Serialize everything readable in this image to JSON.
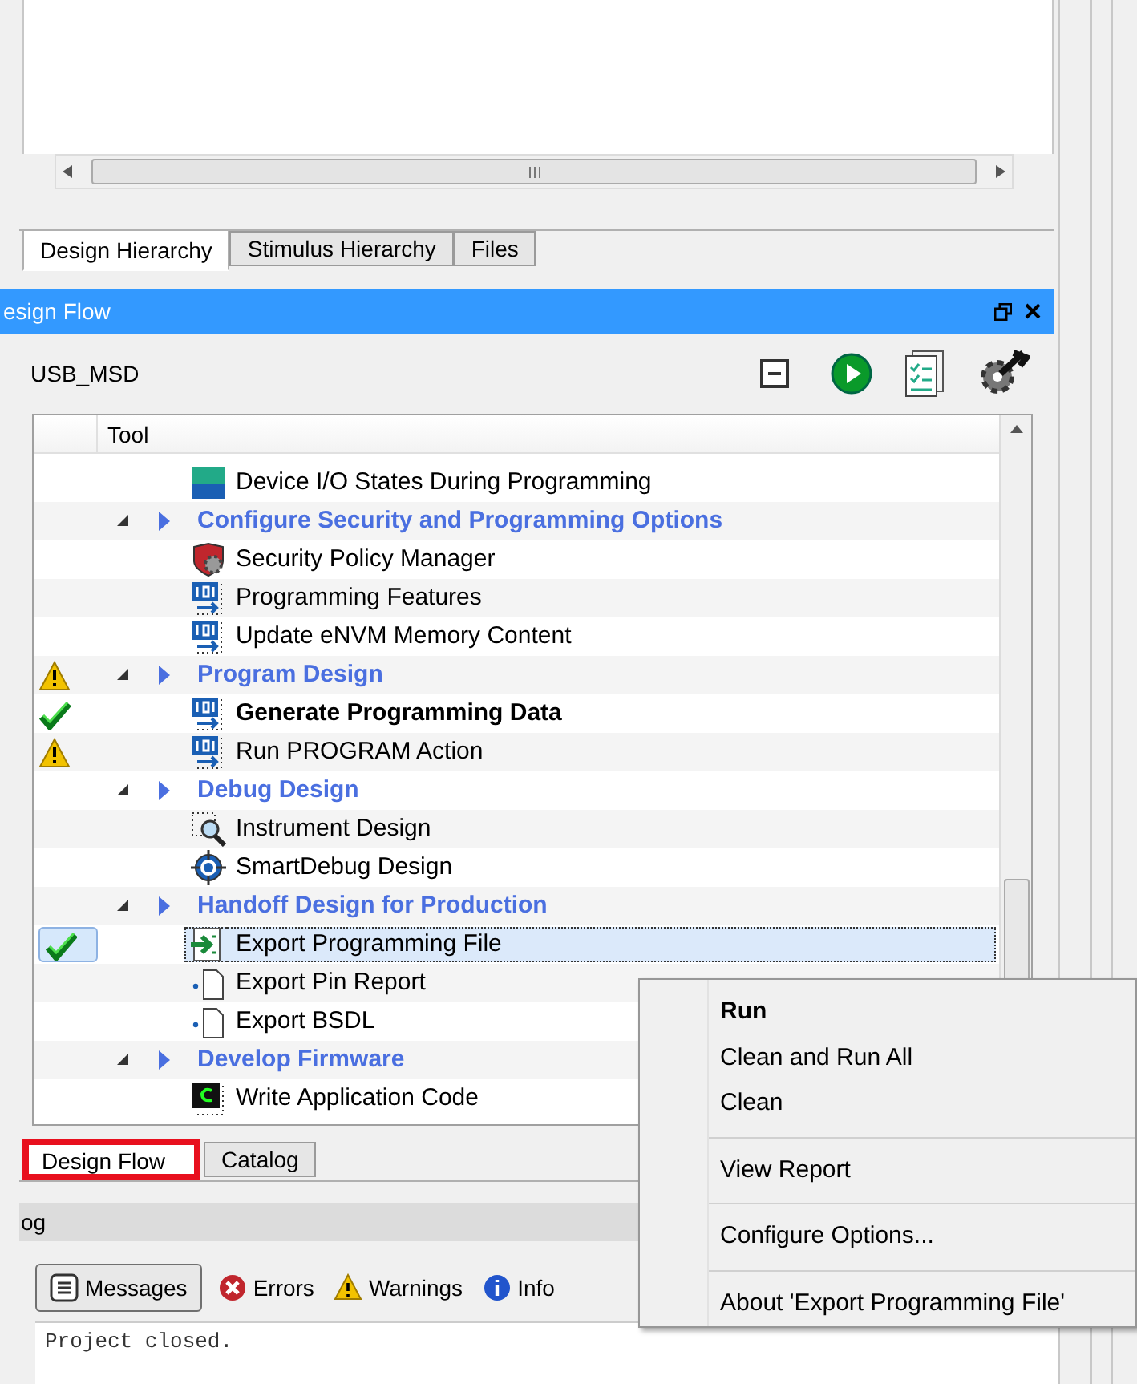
{
  "top_tabs": [
    {
      "label": "Design Hierarchy",
      "selected": true
    },
    {
      "label": "Stimulus Hierarchy",
      "selected": false
    },
    {
      "label": "Files",
      "selected": false
    }
  ],
  "panel": {
    "title": "esign Flow",
    "project": "USB_MSD"
  },
  "tree": {
    "column": "Tool",
    "items": [
      {
        "kind": "io",
        "label": "Device I/O States During Programming",
        "warning": false,
        "done": false,
        "bold": false,
        "selected": false
      },
      {
        "kind": "group",
        "label": "Configure Security and Programming Options",
        "expanded": true,
        "warning": false,
        "done": false,
        "children": [
          {
            "kind": "security",
            "label": "Security Policy Manager",
            "warning": false,
            "done": false,
            "bold": false,
            "selected": false
          },
          {
            "kind": "binary",
            "label": "Programming Features",
            "warning": false,
            "done": false,
            "bold": false,
            "selected": false
          },
          {
            "kind": "binary",
            "label": "Update eNVM Memory Content",
            "warning": false,
            "done": false,
            "bold": false,
            "selected": false
          }
        ]
      },
      {
        "kind": "group",
        "label": "Program Design",
        "expanded": true,
        "warning": true,
        "done": false,
        "children": [
          {
            "kind": "binary",
            "label": "Generate Programming Data",
            "warning": false,
            "done": true,
            "bold": true,
            "selected": false
          },
          {
            "kind": "binary",
            "label": "Run PROGRAM Action",
            "warning": true,
            "done": false,
            "bold": false,
            "selected": false
          }
        ]
      },
      {
        "kind": "group",
        "label": "Debug Design",
        "expanded": true,
        "warning": false,
        "done": false,
        "children": [
          {
            "kind": "instrument",
            "label": "Instrument Design",
            "warning": false,
            "done": false,
            "bold": false,
            "selected": false
          },
          {
            "kind": "debug",
            "label": "SmartDebug Design",
            "warning": false,
            "done": false,
            "bold": false,
            "selected": false
          }
        ]
      },
      {
        "kind": "group",
        "label": "Handoff Design for Production",
        "expanded": true,
        "warning": false,
        "done": false,
        "children": [
          {
            "kind": "export",
            "label": "Export Programming File",
            "warning": false,
            "done": true,
            "bold": false,
            "selected": true
          },
          {
            "kind": "file",
            "label": "Export Pin Report",
            "warning": false,
            "done": false,
            "bold": false,
            "selected": false
          },
          {
            "kind": "file",
            "label": "Export BSDL",
            "warning": false,
            "done": false,
            "bold": false,
            "selected": false
          }
        ]
      },
      {
        "kind": "group",
        "label": "Develop Firmware",
        "expanded": true,
        "warning": false,
        "done": false,
        "children": [
          {
            "kind": "code",
            "label": "Write Application Code",
            "warning": false,
            "done": false,
            "bold": false,
            "selected": false
          }
        ]
      }
    ]
  },
  "bottom_tabs": [
    {
      "label": "Design Flow",
      "selected": true,
      "highlighted": true
    },
    {
      "label": "Catalog",
      "selected": false,
      "highlighted": false
    }
  ],
  "log": {
    "title": "og",
    "filters": [
      {
        "kind": "messages",
        "label": "Messages",
        "selected": true
      },
      {
        "kind": "errors",
        "label": "Errors",
        "selected": false
      },
      {
        "kind": "warnings",
        "label": "Warnings",
        "selected": false
      },
      {
        "kind": "info",
        "label": "Info",
        "selected": false
      }
    ],
    "text": "Project closed."
  },
  "context_menu": [
    {
      "kind": "item",
      "label": "Run",
      "bold": true
    },
    {
      "kind": "item",
      "label": "Clean and Run All",
      "bold": false
    },
    {
      "kind": "item",
      "label": "Clean",
      "bold": false
    },
    {
      "kind": "separator"
    },
    {
      "kind": "item",
      "label": "View Report",
      "bold": false
    },
    {
      "kind": "separator"
    },
    {
      "kind": "item",
      "label": "Configure Options...",
      "bold": false
    },
    {
      "kind": "separator"
    },
    {
      "kind": "item",
      "label": "About 'Export Programming File'",
      "bold": false
    }
  ]
}
